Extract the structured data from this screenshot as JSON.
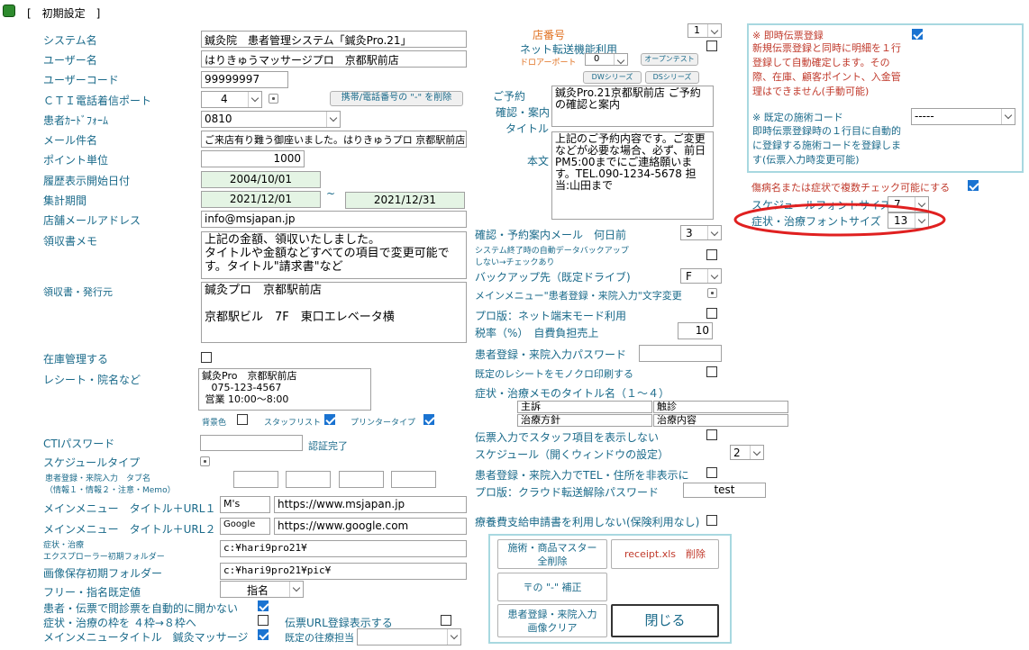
{
  "window": {
    "title": "[　初期設定　]"
  },
  "left": {
    "system_name": {
      "label": "システム名",
      "value": "鍼灸院　患者管理システム「鍼灸Pro.21」"
    },
    "user_name": {
      "label": "ユーザー名",
      "value": "はりきゅうマッサージプロ　京都駅前店"
    },
    "user_code": {
      "label": "ユーザーコード",
      "value": "99999997"
    },
    "cti_port": {
      "label": "ＣＴＩ電話着信ポート",
      "value": "4"
    },
    "delete_hyphen_button": "携帯/電話番号の \"-\" を削除",
    "card_form": {
      "label": "患者ｶｰﾄﾞﾌｫｰﾑ",
      "value": "0810"
    },
    "mail_subject": {
      "label": "メール件名",
      "value": "ご来店有り難う御座いました。はりきゅうプロ 京都駅前店"
    },
    "point_unit": {
      "label": "ポイント単位",
      "value": "1000"
    },
    "history_start": {
      "label": "履歴表示開始日付",
      "value": "2004/10/01"
    },
    "period": {
      "label": "集計期間",
      "from": "2021/12/01",
      "tilde": "~",
      "to": "2021/12/31"
    },
    "shop_mail": {
      "label": "店舗メールアドレス",
      "value": "info@msjapan.jp"
    },
    "receipt_memo": {
      "label": "領収書メモ",
      "value": "上記の金額、領収いたしました。\nタイトルや金額などすべての項目で変更可能です。タイトル\"請求書\"など"
    },
    "receipt_issuer": {
      "label": "領収書・発行元",
      "value": "鍼灸プロ　京都駅前店\n\n京都駅ビル　7F　東口エレベータ横"
    },
    "inventory": {
      "label": "在庫管理する"
    },
    "receipt_name": {
      "label": "レシート・院名など",
      "value": "鍼灸Pro　京都駅前店\n   075-123-4567\n 営業 10:00～8:00"
    },
    "bg_color": "背景色",
    "staff_list": "スタッフリスト",
    "printer_type": "プリンタータイプ",
    "cti_password": {
      "label": "CTIパスワード",
      "status": "認証完了"
    },
    "schedule_type": {
      "label": "スケジュールタイプ"
    },
    "tab_names": {
      "label": "患者登録・来院入力　タブ名",
      "sub": "（情報１・情報２・注意・Memo）"
    },
    "menu_url1": {
      "label": "メインメニュー　タイトル＋URL１",
      "title": "M's",
      "url": "https://www.msjapan.jp"
    },
    "menu_url2": {
      "label": "メインメニュー　タイトル＋URL２",
      "title": "Google",
      "url": "https://www.google.com"
    },
    "explorer_folder": {
      "label1": "症状・治療",
      "label2": "エクスプローラー初期フォルダー",
      "value": "c:¥hari9pro21¥"
    },
    "image_folder": {
      "label": "画像保存初期フォルダー",
      "value": "c:¥hari9pro21¥pic¥"
    },
    "free_designation": {
      "label": "フリー・指名既定値",
      "value": "指名"
    },
    "auto_open": {
      "label": "患者・伝票で問診票を自動的に開かない"
    },
    "frame_4to8": {
      "label": "症状・治療の枠を ４枠→８枠へ"
    },
    "menu_title": {
      "label": "メインメニュータイトル　鍼灸マッサージ"
    },
    "slip_url": {
      "label": "伝票URL登録表示する"
    },
    "default_staff": {
      "label": "既定の往療担当"
    }
  },
  "middle": {
    "shop_no": {
      "label": "店番号",
      "value": "1"
    },
    "net_transfer": {
      "label": "ネット転送機能利用"
    },
    "drawer_port": {
      "label": "ドロアーポート",
      "value": "0"
    },
    "open_test": "オープンテスト",
    "dw_series": "DWシリーズ",
    "ds_series": "DSシリーズ",
    "reservation": {
      "label1": "ご予約",
      "label2": "確認・案内",
      "label3": "タイトル",
      "value": "鍼灸Pro.21京都駅前店 ご予約の確認と案内"
    },
    "body": {
      "label": "本文",
      "value": "上記のご予約内容です。ご変更などが必要な場合、必ず、前日PM5:00までにご連絡願います。TEL.090-1234-5678 担当:山田まで"
    },
    "reminder_days": {
      "label": "確認・予約案内メール　何日前",
      "value": "3"
    },
    "auto_backup": {
      "label1": "システム終了時の自動データバックアップ",
      "label2": "しない→チェックあり"
    },
    "backup_drive": {
      "label": "バックアップ先（既定ドライブ)",
      "value": "F"
    },
    "menu_text": {
      "label": "メインメニュー\"患者登録・来院入力\"文字変更"
    },
    "pro_terminal": {
      "label": "プロ版：ネット端末モード利用"
    },
    "tax": {
      "label": "税率（%）　自費負担売上",
      "value": "10"
    },
    "visit_password": {
      "label": "患者登録・来院入力パスワード"
    },
    "mono_receipt": {
      "label": "既定のレシートをモノクロ印刷する"
    },
    "memo_titles": {
      "label": "症状・治療メモのタイトル名（１～４）",
      "t1": "主訴",
      "t2": "触診",
      "t3": "治療方針",
      "t4": "治療内容"
    },
    "hide_staff": {
      "label": "伝票入力でスタッフ項目を表示しない"
    },
    "schedule_window": {
      "label": "スケジュール（開くウィンドウの設定）",
      "value": "2"
    },
    "hide_tel": {
      "label": "患者登録・来院入力でTEL・住所を非表示に"
    },
    "cloud_password": {
      "label": "プロ版：クラウド転送解除パスワード",
      "value": "test"
    },
    "no_medical_fee": {
      "label": "療養費支給申請書を利用しない(保険利用なし)"
    }
  },
  "right": {
    "instant_slip": {
      "title": "※ 即時伝票登録",
      "desc": "新規伝票登録と同時に明細を１行登録して自動確定します。その際、在庫、顧客ポイント、入金管理はできません(手動可能)"
    },
    "default_code": {
      "title": "※ 既定の施術コード",
      "desc": "即時伝票登録時の１行目に自動的に登録する施術コードを登録します(伝票入力時変更可能)",
      "value": "-----"
    },
    "multi_check": {
      "label": "傷病名または症状で複数チェック可能にする"
    },
    "schedule_font": {
      "label": "スケジュールフォントサイズ",
      "value": "7"
    },
    "symptom_font": {
      "label": "症状・治療フォントサイズ",
      "value": "13"
    }
  },
  "actions": {
    "master_delete": "施術・商品マスター\n全削除",
    "receipt_delete": "receipt.xls　削除",
    "hyphen_fix": "〒の \"-\" 補正",
    "image_clear": "患者登録・来院入力\n画像クリア",
    "close": "閉じる"
  },
  "colors": {
    "label": "#1a6a8a",
    "highlight_ellipse": "#e02020",
    "frame": "#a8d8e0",
    "checkbox_on": "#1a73d1"
  }
}
